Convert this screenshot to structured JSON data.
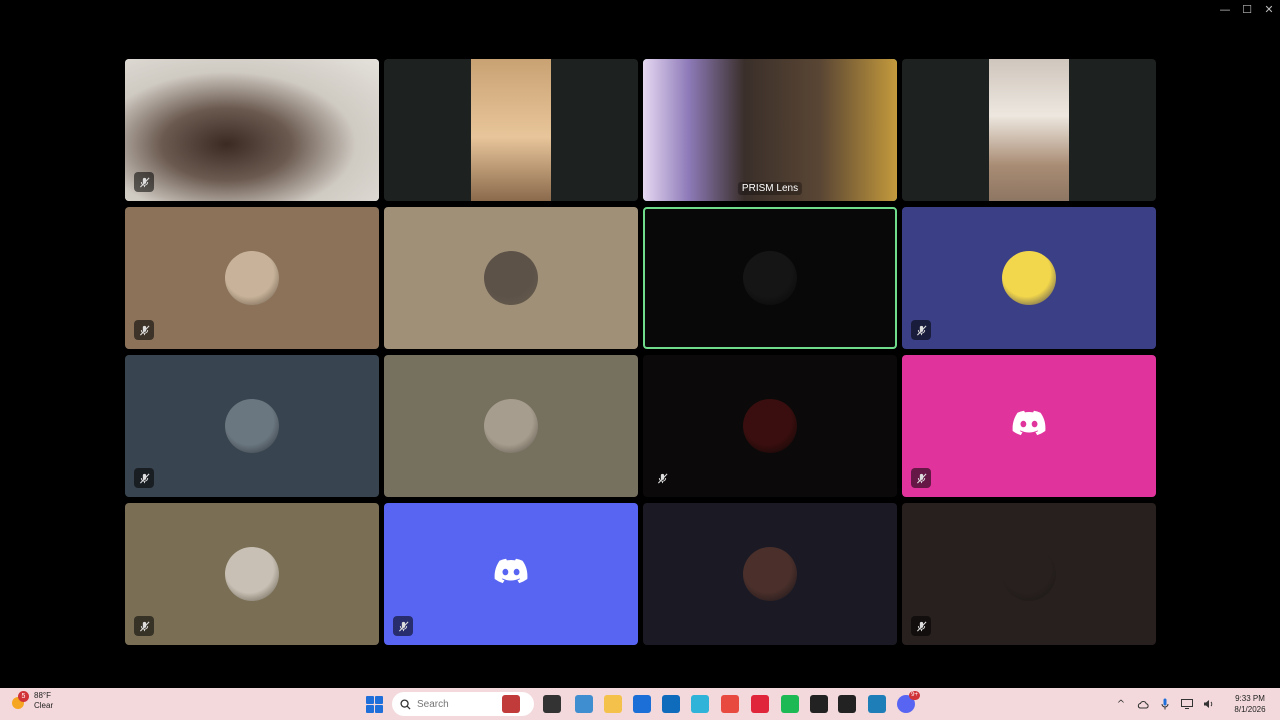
{
  "window": {
    "controls": {
      "minimize": "—",
      "maximize": "☐",
      "close": "✕"
    }
  },
  "tiles": [
    {
      "type": "video",
      "bg": "#d8d4cc",
      "muted": true
    },
    {
      "type": "video",
      "bg": "#1d2120",
      "muted": false
    },
    {
      "type": "video",
      "bg": "#2b2430",
      "muted": false,
      "speaking": true,
      "label": "PRISM Lens"
    },
    {
      "type": "video",
      "bg": "#1d2120",
      "muted": false
    },
    {
      "type": "avatar",
      "bg": "#8b7259",
      "avatar_color": "#c8b39a",
      "muted": true
    },
    {
      "type": "avatar",
      "bg": "#a09078",
      "avatar_color": "#5c5248",
      "muted": false
    },
    {
      "type": "avatar",
      "bg": "#080808",
      "avatar_color": "#151515",
      "muted": false,
      "speaking": true
    },
    {
      "type": "avatar",
      "bg": "#3b3f86",
      "avatar_color": "#f2d64b",
      "muted": true
    },
    {
      "type": "avatar",
      "bg": "#38444f",
      "avatar_color": "#6b7780",
      "muted": true
    },
    {
      "type": "avatar",
      "bg": "#76705f",
      "avatar_color": "#a79d8e",
      "muted": false
    },
    {
      "type": "avatar",
      "bg": "#0b0909",
      "avatar_color": "#3a0e0e",
      "muted": true
    },
    {
      "type": "discord",
      "bg": "#e0349c",
      "muted": true
    },
    {
      "type": "avatar",
      "bg": "#7a6f55",
      "avatar_color": "#c8c0b4",
      "muted": true
    },
    {
      "type": "discord",
      "bg": "#5865f2",
      "muted": true
    },
    {
      "type": "avatar",
      "bg": "#1b1a24",
      "avatar_color": "#4a2f2a",
      "muted": false
    },
    {
      "type": "avatar",
      "bg": "#27201e",
      "avatar_color": "#27201e",
      "muted": true
    }
  ],
  "taskbar": {
    "weather": {
      "temperature": "88°F",
      "condition": "Clear",
      "badge": "5"
    },
    "search": {
      "placeholder": "Search"
    },
    "apps": [
      {
        "icon": "shoe-widget-icon",
        "color": "#c23b3b"
      },
      {
        "icon": "task-view-icon",
        "color": "#333333"
      },
      {
        "icon": "microsoft-365-icon",
        "color": "#3e8ed0"
      },
      {
        "icon": "file-explorer-icon",
        "color": "#f4c24a"
      },
      {
        "icon": "microsoft-store-icon",
        "color": "#1b6fd6"
      },
      {
        "icon": "outlook-icon",
        "color": "#0f6cbd"
      },
      {
        "icon": "f-app-icon",
        "color": "#30b3d8"
      },
      {
        "icon": "app-6-icon",
        "color": "#e94a3f"
      },
      {
        "icon": "opera-icon",
        "color": "#e0243a"
      },
      {
        "icon": "spotify-icon",
        "color": "#1db954"
      },
      {
        "icon": "recording-app-icon",
        "color": "#222222"
      },
      {
        "icon": "media-app-icon",
        "color": "#222222"
      },
      {
        "icon": "photos-icon",
        "color": "#1e7fb8"
      },
      {
        "icon": "discord-icon",
        "color": "#5865f2"
      }
    ],
    "discord_badge": "9+",
    "tray": {
      "chevron": "^",
      "clock_time": "9:33 PM",
      "clock_date": "8/1/2026"
    }
  }
}
